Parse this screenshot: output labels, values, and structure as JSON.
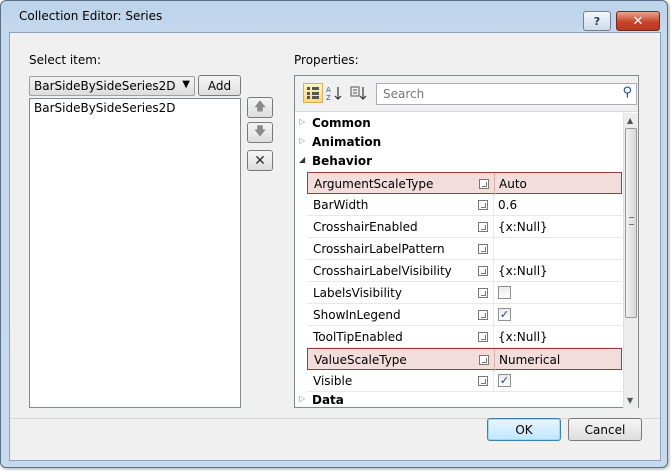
{
  "window": {
    "title": "Collection Editor: Series",
    "help_label": "?",
    "close_label": "✕"
  },
  "left": {
    "label": "Select item:",
    "combo_value": "BarSideBySideSeries2D",
    "add_label": "Add",
    "items": [
      "BarSideBySideSeries2D"
    ]
  },
  "right": {
    "label": "Properties:",
    "search_placeholder": "Search",
    "categories": {
      "common": "Common",
      "animation": "Animation",
      "behavior": "Behavior",
      "data": "Data"
    },
    "properties": [
      {
        "name": "ArgumentScaleType",
        "value": "Auto"
      },
      {
        "name": "BarWidth",
        "value": "0.6"
      },
      {
        "name": "CrosshairEnabled",
        "value": "{x:Null}"
      },
      {
        "name": "CrosshairLabelPattern",
        "value": ""
      },
      {
        "name": "CrosshairLabelVisibility",
        "value": "{x:Null}"
      },
      {
        "name": "LabelsVisibility",
        "value": "unchecked"
      },
      {
        "name": "ShowInLegend",
        "value": "checked"
      },
      {
        "name": "ToolTipEnabled",
        "value": "{x:Null}"
      },
      {
        "name": "ValueScaleType",
        "value": "Numerical"
      },
      {
        "name": "Visible",
        "value": "checked"
      }
    ],
    "check_glyph": "✓"
  },
  "footer": {
    "ok_label": "OK",
    "cancel_label": "Cancel"
  },
  "colors": {
    "highlight_border": "#9e3a3a",
    "highlight_fill": "#f2dcdc",
    "title_bar": "#c4d8ee"
  }
}
